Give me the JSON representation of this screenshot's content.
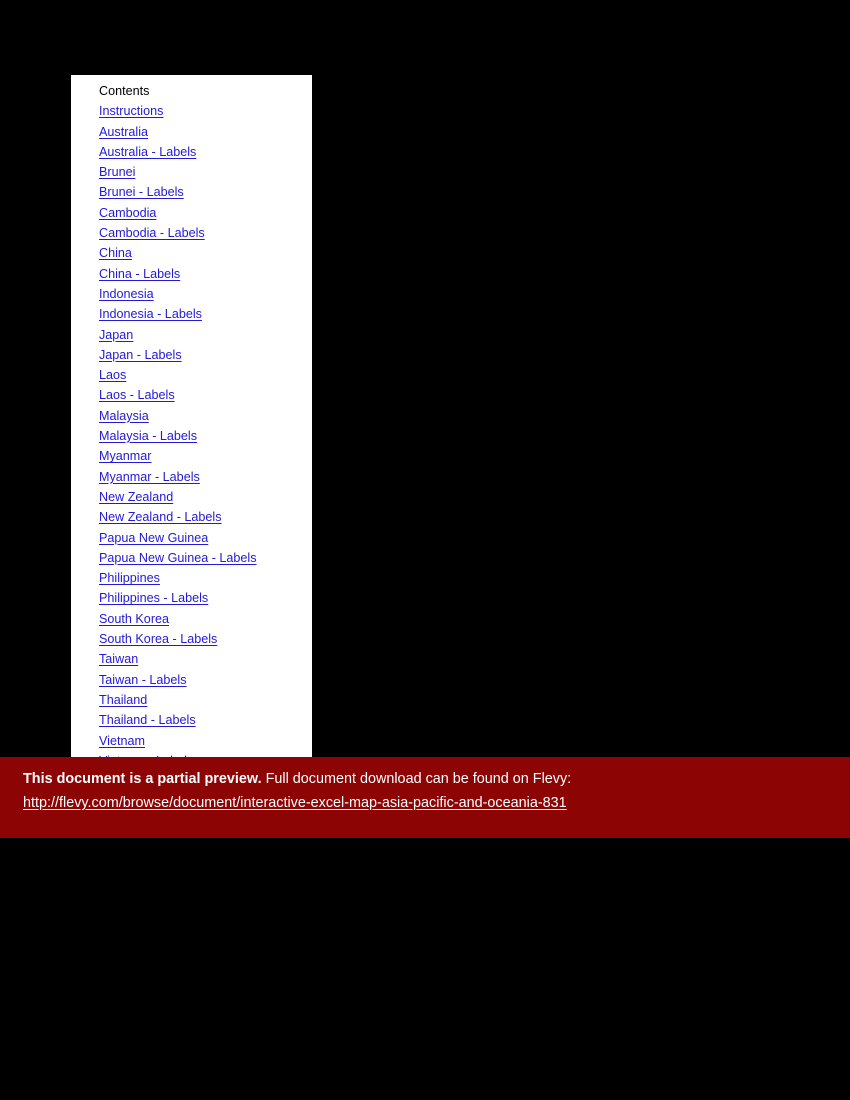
{
  "page": {
    "background_color": "#000000",
    "document_background": "#ffffff"
  },
  "document": {
    "contents_heading": "Contents",
    "link_color": "#2419d6",
    "items": [
      {
        "label": "Instructions"
      },
      {
        "label": "Australia"
      },
      {
        "label": "Australia - Labels"
      },
      {
        "label": "Brunei"
      },
      {
        "label": "Brunei - Labels"
      },
      {
        "label": "Cambodia"
      },
      {
        "label": "Cambodia - Labels"
      },
      {
        "label": "China"
      },
      {
        "label": "China - Labels"
      },
      {
        "label": "Indonesia"
      },
      {
        "label": "Indonesia - Labels"
      },
      {
        "label": "Japan"
      },
      {
        "label": "Japan - Labels"
      },
      {
        "label": "Laos"
      },
      {
        "label": "Laos - Labels"
      },
      {
        "label": "Malaysia"
      },
      {
        "label": "Malaysia - Labels"
      },
      {
        "label": "Myanmar"
      },
      {
        "label": "Myanmar - Labels"
      },
      {
        "label": "New Zealand"
      },
      {
        "label": "New Zealand - Labels"
      },
      {
        "label": "Papua New Guinea"
      },
      {
        "label": "Papua New Guinea - Labels"
      },
      {
        "label": "Philippines"
      },
      {
        "label": "Philippines - Labels"
      },
      {
        "label": "South Korea"
      },
      {
        "label": "South Korea - Labels"
      },
      {
        "label": "Taiwan"
      },
      {
        "label": "Taiwan - Labels"
      },
      {
        "label": "Thailand"
      },
      {
        "label": "Thailand - Labels"
      },
      {
        "label": "Vietnam"
      },
      {
        "label": "Vietnam - Labels"
      }
    ]
  },
  "banner": {
    "background_color": "#8c0404",
    "text_color": "#ffffff",
    "notice_bold": "This document is a partial preview.",
    "notice_rest": "Full document download can be found on Flevy:",
    "url": "http://flevy.com/browse/document/interactive-excel-map-asia-pacific-and-oceania-831"
  }
}
